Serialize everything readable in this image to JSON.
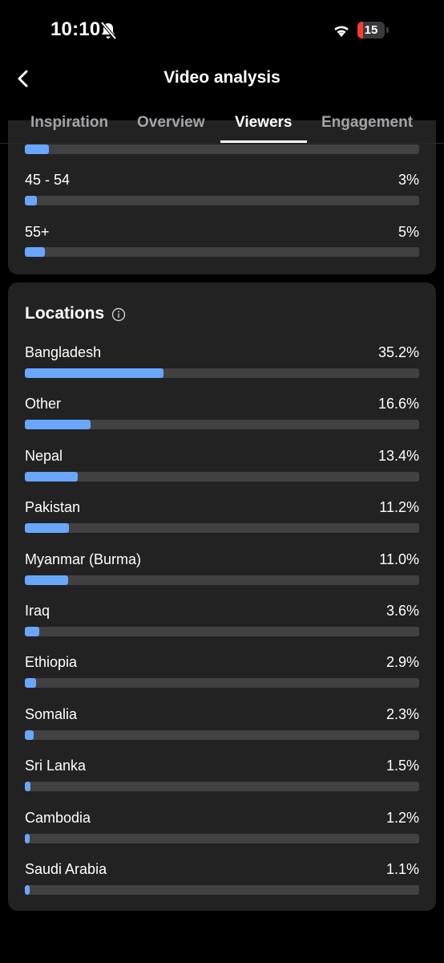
{
  "status_bar": {
    "time": "10:10",
    "battery_level": "15",
    "battery_color": "#ff3b30"
  },
  "header": {
    "title": "Video analysis"
  },
  "tabs": [
    {
      "label": "Inspiration",
      "active": false
    },
    {
      "label": "Overview",
      "active": false
    },
    {
      "label": "Viewers",
      "active": true
    },
    {
      "label": "Engagement",
      "active": false
    }
  ],
  "age_rows": [
    {
      "label": "",
      "value": "",
      "percent": 6
    },
    {
      "label": "45 - 54",
      "value": "3%",
      "percent": 3
    },
    {
      "label": "55+",
      "value": "5%",
      "percent": 5
    }
  ],
  "locations": {
    "title": "Locations",
    "rows": [
      {
        "label": "Bangladesh",
        "value": "35.2%",
        "percent": 35.2
      },
      {
        "label": "Other",
        "value": "16.6%",
        "percent": 16.6
      },
      {
        "label": "Nepal",
        "value": "13.4%",
        "percent": 13.4
      },
      {
        "label": "Pakistan",
        "value": "11.2%",
        "percent": 11.2
      },
      {
        "label": "Myanmar (Burma)",
        "value": "11.0%",
        "percent": 11.0
      },
      {
        "label": "Iraq",
        "value": "3.6%",
        "percent": 3.6
      },
      {
        "label": "Ethiopia",
        "value": "2.9%",
        "percent": 2.9
      },
      {
        "label": "Somalia",
        "value": "2.3%",
        "percent": 2.3
      },
      {
        "label": "Sri Lanka",
        "value": "1.5%",
        "percent": 1.5
      },
      {
        "label": "Cambodia",
        "value": "1.2%",
        "percent": 1.2
      },
      {
        "label": "Saudi Arabia",
        "value": "1.1%",
        "percent": 1.1
      }
    ]
  },
  "colors": {
    "bar_fill": "#69a7ff",
    "bar_track": "#414141",
    "card_bg": "#222222",
    "background": "#000000"
  }
}
